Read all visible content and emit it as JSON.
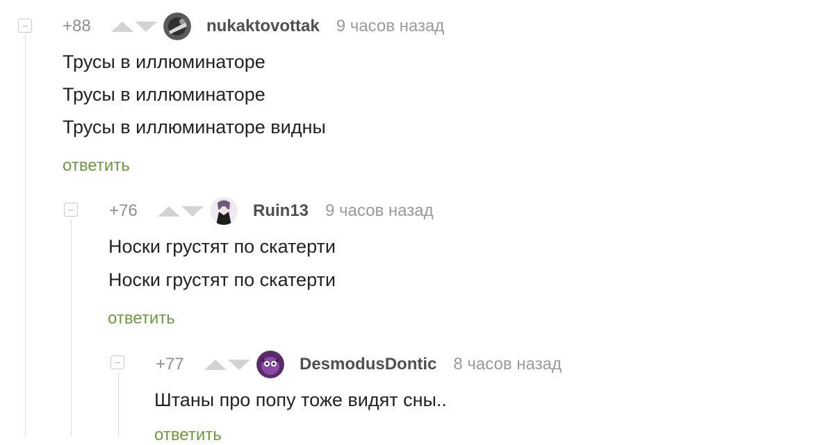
{
  "comments": [
    {
      "rating": "+88",
      "username": "nukaktovottak",
      "time": "9 часов назад",
      "lines": [
        "Трусы в иллюминаторе",
        "Трусы в иллюминаторе",
        "Трусы в иллюминаторе видны"
      ],
      "reply_label": "ответить",
      "avatar_icon": "user-avatar-icon"
    },
    {
      "rating": "+76",
      "username": "Ruin13",
      "time": "9 часов назад",
      "lines": [
        "Носки грустят по скатерти",
        "Носки грустят по скатерти"
      ],
      "reply_label": "ответить",
      "avatar_icon": "user-avatar-icon"
    },
    {
      "rating": "+77",
      "username": "DesmodusDontic",
      "time": "8 часов назад",
      "lines": [
        "Штаны про попу тоже видят сны.."
      ],
      "reply_label": "ответить",
      "avatar_icon": "user-avatar-icon"
    }
  ],
  "colors": {
    "reply_link": "#6c9a3f",
    "username": "#4f4f4f",
    "meta_text": "#9a9a9a",
    "vote_arrow": "#d3d3d3"
  }
}
